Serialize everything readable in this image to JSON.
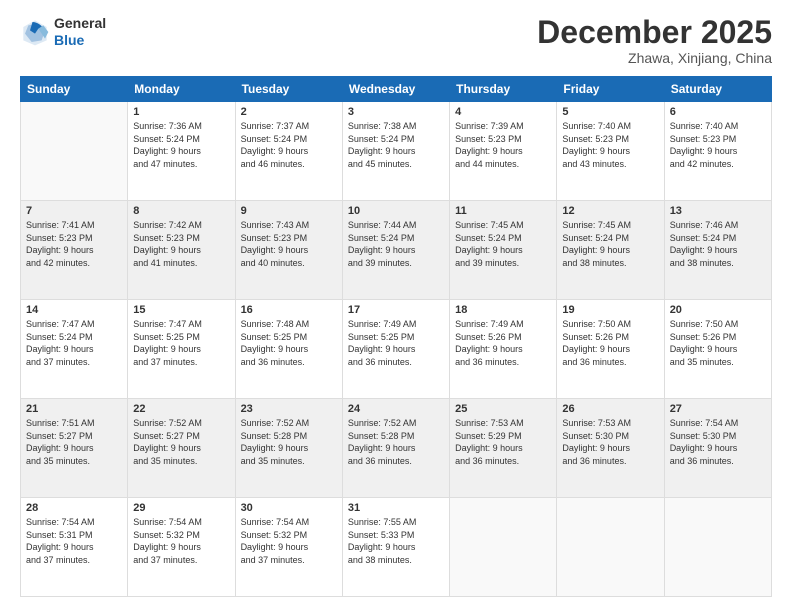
{
  "header": {
    "logo_general": "General",
    "logo_blue": "Blue",
    "main_title": "December 2025",
    "subtitle": "Zhawa, Xinjiang, China"
  },
  "days_of_week": [
    "Sunday",
    "Monday",
    "Tuesday",
    "Wednesday",
    "Thursday",
    "Friday",
    "Saturday"
  ],
  "weeks": [
    [
      {
        "day": "",
        "info": ""
      },
      {
        "day": "1",
        "info": "Sunrise: 7:36 AM\nSunset: 5:24 PM\nDaylight: 9 hours\nand 47 minutes."
      },
      {
        "day": "2",
        "info": "Sunrise: 7:37 AM\nSunset: 5:24 PM\nDaylight: 9 hours\nand 46 minutes."
      },
      {
        "day": "3",
        "info": "Sunrise: 7:38 AM\nSunset: 5:24 PM\nDaylight: 9 hours\nand 45 minutes."
      },
      {
        "day": "4",
        "info": "Sunrise: 7:39 AM\nSunset: 5:23 PM\nDaylight: 9 hours\nand 44 minutes."
      },
      {
        "day": "5",
        "info": "Sunrise: 7:40 AM\nSunset: 5:23 PM\nDaylight: 9 hours\nand 43 minutes."
      },
      {
        "day": "6",
        "info": "Sunrise: 7:40 AM\nSunset: 5:23 PM\nDaylight: 9 hours\nand 42 minutes."
      }
    ],
    [
      {
        "day": "7",
        "info": "Sunrise: 7:41 AM\nSunset: 5:23 PM\nDaylight: 9 hours\nand 42 minutes."
      },
      {
        "day": "8",
        "info": "Sunrise: 7:42 AM\nSunset: 5:23 PM\nDaylight: 9 hours\nand 41 minutes."
      },
      {
        "day": "9",
        "info": "Sunrise: 7:43 AM\nSunset: 5:23 PM\nDaylight: 9 hours\nand 40 minutes."
      },
      {
        "day": "10",
        "info": "Sunrise: 7:44 AM\nSunset: 5:24 PM\nDaylight: 9 hours\nand 39 minutes."
      },
      {
        "day": "11",
        "info": "Sunrise: 7:45 AM\nSunset: 5:24 PM\nDaylight: 9 hours\nand 39 minutes."
      },
      {
        "day": "12",
        "info": "Sunrise: 7:45 AM\nSunset: 5:24 PM\nDaylight: 9 hours\nand 38 minutes."
      },
      {
        "day": "13",
        "info": "Sunrise: 7:46 AM\nSunset: 5:24 PM\nDaylight: 9 hours\nand 38 minutes."
      }
    ],
    [
      {
        "day": "14",
        "info": "Sunrise: 7:47 AM\nSunset: 5:24 PM\nDaylight: 9 hours\nand 37 minutes."
      },
      {
        "day": "15",
        "info": "Sunrise: 7:47 AM\nSunset: 5:25 PM\nDaylight: 9 hours\nand 37 minutes."
      },
      {
        "day": "16",
        "info": "Sunrise: 7:48 AM\nSunset: 5:25 PM\nDaylight: 9 hours\nand 36 minutes."
      },
      {
        "day": "17",
        "info": "Sunrise: 7:49 AM\nSunset: 5:25 PM\nDaylight: 9 hours\nand 36 minutes."
      },
      {
        "day": "18",
        "info": "Sunrise: 7:49 AM\nSunset: 5:26 PM\nDaylight: 9 hours\nand 36 minutes."
      },
      {
        "day": "19",
        "info": "Sunrise: 7:50 AM\nSunset: 5:26 PM\nDaylight: 9 hours\nand 36 minutes."
      },
      {
        "day": "20",
        "info": "Sunrise: 7:50 AM\nSunset: 5:26 PM\nDaylight: 9 hours\nand 35 minutes."
      }
    ],
    [
      {
        "day": "21",
        "info": "Sunrise: 7:51 AM\nSunset: 5:27 PM\nDaylight: 9 hours\nand 35 minutes."
      },
      {
        "day": "22",
        "info": "Sunrise: 7:52 AM\nSunset: 5:27 PM\nDaylight: 9 hours\nand 35 minutes."
      },
      {
        "day": "23",
        "info": "Sunrise: 7:52 AM\nSunset: 5:28 PM\nDaylight: 9 hours\nand 35 minutes."
      },
      {
        "day": "24",
        "info": "Sunrise: 7:52 AM\nSunset: 5:28 PM\nDaylight: 9 hours\nand 36 minutes."
      },
      {
        "day": "25",
        "info": "Sunrise: 7:53 AM\nSunset: 5:29 PM\nDaylight: 9 hours\nand 36 minutes."
      },
      {
        "day": "26",
        "info": "Sunrise: 7:53 AM\nSunset: 5:30 PM\nDaylight: 9 hours\nand 36 minutes."
      },
      {
        "day": "27",
        "info": "Sunrise: 7:54 AM\nSunset: 5:30 PM\nDaylight: 9 hours\nand 36 minutes."
      }
    ],
    [
      {
        "day": "28",
        "info": "Sunrise: 7:54 AM\nSunset: 5:31 PM\nDaylight: 9 hours\nand 37 minutes."
      },
      {
        "day": "29",
        "info": "Sunrise: 7:54 AM\nSunset: 5:32 PM\nDaylight: 9 hours\nand 37 minutes."
      },
      {
        "day": "30",
        "info": "Sunrise: 7:54 AM\nSunset: 5:32 PM\nDaylight: 9 hours\nand 37 minutes."
      },
      {
        "day": "31",
        "info": "Sunrise: 7:55 AM\nSunset: 5:33 PM\nDaylight: 9 hours\nand 38 minutes."
      },
      {
        "day": "",
        "info": ""
      },
      {
        "day": "",
        "info": ""
      },
      {
        "day": "",
        "info": ""
      }
    ]
  ]
}
